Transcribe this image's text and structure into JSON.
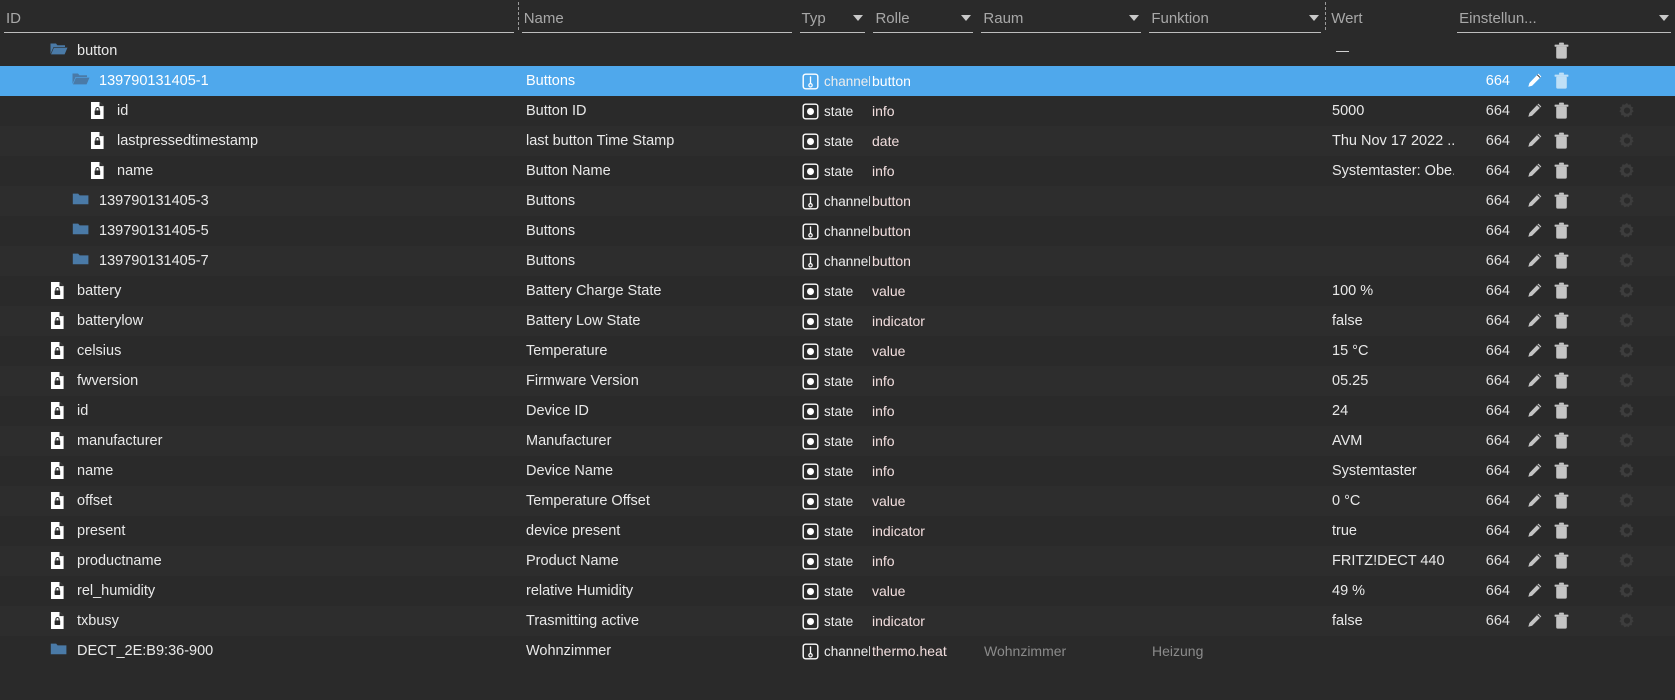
{
  "header": {
    "columns": [
      {
        "key": "id",
        "label": "ID",
        "caret": false,
        "underlined": true,
        "dashed_left": false
      },
      {
        "key": "name",
        "label": "Name",
        "caret": false,
        "underlined": true,
        "dashed_left": true
      },
      {
        "key": "typ",
        "label": "Typ",
        "caret": true,
        "underlined": true,
        "dashed_left": false
      },
      {
        "key": "rolle",
        "label": "Rolle",
        "caret": true,
        "underlined": true,
        "dashed_left": false
      },
      {
        "key": "raum",
        "label": "Raum",
        "caret": true,
        "underlined": true,
        "dashed_left": false
      },
      {
        "key": "funktion",
        "label": "Funktion",
        "caret": true,
        "underlined": true,
        "dashed_left": false
      },
      {
        "key": "wert",
        "label": "Wert",
        "caret": false,
        "underlined": false,
        "dashed_left": true
      },
      {
        "key": "settings",
        "label": "Einstellun...",
        "caret": true,
        "underlined": true,
        "dashed_left": false
      }
    ]
  },
  "colors": {
    "background": "#2a2a2a",
    "row_alt": "#2d2d2d",
    "selected": "#4fa8ec",
    "folder_blue": "#4a7aa7",
    "text": "#e9e9e9",
    "muted": "#8b8b8b",
    "role_text": "#f2dede",
    "gear_dim": "#3d3d3d"
  },
  "icons": {
    "folder_open": "folder-open-icon",
    "folder_closed": "folder-closed-icon",
    "state_file": "locked-file-icon",
    "channel": "channel-icon",
    "state": "state-icon",
    "edit": "pencil-icon",
    "delete": "trash-icon",
    "settings": "gear-icon",
    "caret": "chevron-down-icon"
  },
  "rows": [
    {
      "id": "button",
      "indent": 1,
      "icon": "folder_open",
      "selected": false,
      "name": "",
      "typ": "",
      "rolle": "",
      "raum": "",
      "funktion": "",
      "wert": "",
      "wert_dash": true,
      "acl": "",
      "edit": false,
      "delete": true,
      "settings": false
    },
    {
      "id": "139790131405-1",
      "indent": 2,
      "icon": "folder_open",
      "selected": true,
      "name": "Buttons",
      "typ": "channel",
      "rolle": "button",
      "raum": "",
      "funktion": "",
      "wert": "",
      "wert_dash": false,
      "acl": "664",
      "edit": true,
      "delete": true,
      "settings": false
    },
    {
      "id": "id",
      "indent": 3,
      "icon": "state_file",
      "selected": false,
      "name": "Button ID",
      "typ": "state",
      "rolle": "info",
      "raum": "",
      "funktion": "",
      "wert": "5000",
      "wert_dash": false,
      "acl": "664",
      "edit": true,
      "delete": true,
      "settings": true
    },
    {
      "id": "lastpressedtimestamp",
      "indent": 3,
      "icon": "state_file",
      "selected": false,
      "name": "last button Time Stamp",
      "typ": "state",
      "rolle": "date",
      "raum": "",
      "funktion": "",
      "wert": "Thu Nov 17 2022 ...",
      "wert_dash": false,
      "acl": "664",
      "edit": true,
      "delete": true,
      "settings": true
    },
    {
      "id": "name",
      "indent": 3,
      "icon": "state_file",
      "selected": false,
      "name": "Button Name",
      "typ": "state",
      "rolle": "info",
      "raum": "",
      "funktion": "",
      "wert": "Systemtaster: Obe...",
      "wert_dash": false,
      "acl": "664",
      "edit": true,
      "delete": true,
      "settings": true
    },
    {
      "id": "139790131405-3",
      "indent": 2,
      "icon": "folder_closed",
      "selected": false,
      "name": "Buttons",
      "typ": "channel",
      "rolle": "button",
      "raum": "",
      "funktion": "",
      "wert": "",
      "wert_dash": false,
      "acl": "664",
      "edit": true,
      "delete": true,
      "settings": true
    },
    {
      "id": "139790131405-5",
      "indent": 2,
      "icon": "folder_closed",
      "selected": false,
      "name": "Buttons",
      "typ": "channel",
      "rolle": "button",
      "raum": "",
      "funktion": "",
      "wert": "",
      "wert_dash": false,
      "acl": "664",
      "edit": true,
      "delete": true,
      "settings": true
    },
    {
      "id": "139790131405-7",
      "indent": 2,
      "icon": "folder_closed",
      "selected": false,
      "name": "Buttons",
      "typ": "channel",
      "rolle": "button",
      "raum": "",
      "funktion": "",
      "wert": "",
      "wert_dash": false,
      "acl": "664",
      "edit": true,
      "delete": true,
      "settings": true
    },
    {
      "id": "battery",
      "indent": 1,
      "icon": "state_file",
      "selected": false,
      "name": "Battery Charge State",
      "typ": "state",
      "rolle": "value",
      "raum": "",
      "funktion": "",
      "wert": "100 %",
      "wert_dash": false,
      "acl": "664",
      "edit": true,
      "delete": true,
      "settings": true
    },
    {
      "id": "batterylow",
      "indent": 1,
      "icon": "state_file",
      "selected": false,
      "name": "Battery Low State",
      "typ": "state",
      "rolle": "indicator",
      "raum": "",
      "funktion": "",
      "wert": "false",
      "wert_dash": false,
      "acl": "664",
      "edit": true,
      "delete": true,
      "settings": true
    },
    {
      "id": "celsius",
      "indent": 1,
      "icon": "state_file",
      "selected": false,
      "name": "Temperature",
      "typ": "state",
      "rolle": "value",
      "raum": "",
      "funktion": "",
      "wert": "15 °C",
      "wert_dash": false,
      "acl": "664",
      "edit": true,
      "delete": true,
      "settings": true
    },
    {
      "id": "fwversion",
      "indent": 1,
      "icon": "state_file",
      "selected": false,
      "name": "Firmware Version",
      "typ": "state",
      "rolle": "info",
      "raum": "",
      "funktion": "",
      "wert": "05.25",
      "wert_dash": false,
      "acl": "664",
      "edit": true,
      "delete": true,
      "settings": true
    },
    {
      "id": "id",
      "indent": 1,
      "icon": "state_file",
      "selected": false,
      "name": "Device ID",
      "typ": "state",
      "rolle": "info",
      "raum": "",
      "funktion": "",
      "wert": "24",
      "wert_dash": false,
      "acl": "664",
      "edit": true,
      "delete": true,
      "settings": true
    },
    {
      "id": "manufacturer",
      "indent": 1,
      "icon": "state_file",
      "selected": false,
      "name": "Manufacturer",
      "typ": "state",
      "rolle": "info",
      "raum": "",
      "funktion": "",
      "wert": "AVM",
      "wert_dash": false,
      "acl": "664",
      "edit": true,
      "delete": true,
      "settings": true
    },
    {
      "id": "name",
      "indent": 1,
      "icon": "state_file",
      "selected": false,
      "name": "Device Name",
      "typ": "state",
      "rolle": "info",
      "raum": "",
      "funktion": "",
      "wert": "Systemtaster",
      "wert_dash": false,
      "acl": "664",
      "edit": true,
      "delete": true,
      "settings": true
    },
    {
      "id": "offset",
      "indent": 1,
      "icon": "state_file",
      "selected": false,
      "name": "Temperature Offset",
      "typ": "state",
      "rolle": "value",
      "raum": "",
      "funktion": "",
      "wert": "0 °C",
      "wert_dash": false,
      "acl": "664",
      "edit": true,
      "delete": true,
      "settings": true
    },
    {
      "id": "present",
      "indent": 1,
      "icon": "state_file",
      "selected": false,
      "name": "device present",
      "typ": "state",
      "rolle": "indicator",
      "raum": "",
      "funktion": "",
      "wert": "true",
      "wert_dash": false,
      "acl": "664",
      "edit": true,
      "delete": true,
      "settings": true
    },
    {
      "id": "productname",
      "indent": 1,
      "icon": "state_file",
      "selected": false,
      "name": "Product Name",
      "typ": "state",
      "rolle": "info",
      "raum": "",
      "funktion": "",
      "wert": "FRITZ!DECT 440",
      "wert_dash": false,
      "acl": "664",
      "edit": true,
      "delete": true,
      "settings": true
    },
    {
      "id": "rel_humidity",
      "indent": 1,
      "icon": "state_file",
      "selected": false,
      "name": "relative Humidity",
      "typ": "state",
      "rolle": "value",
      "raum": "",
      "funktion": "",
      "wert": "49 %",
      "wert_dash": false,
      "acl": "664",
      "edit": true,
      "delete": true,
      "settings": true
    },
    {
      "id": "txbusy",
      "indent": 1,
      "icon": "state_file",
      "selected": false,
      "name": "Trasmitting active",
      "typ": "state",
      "rolle": "indicator",
      "raum": "",
      "funktion": "",
      "wert": "false",
      "wert_dash": false,
      "acl": "664",
      "edit": true,
      "delete": true,
      "settings": true
    },
    {
      "id": "DECT_2E:B9:36-900",
      "indent": 1,
      "icon": "folder_closed",
      "selected": false,
      "name": "Wohnzimmer",
      "typ": "channel",
      "rolle": "thermo.heat",
      "raum": "Wohnzimmer",
      "funktion": "Heizung",
      "wert": "",
      "wert_dash": false,
      "acl": "",
      "edit": false,
      "delete": false,
      "settings": false
    }
  ]
}
